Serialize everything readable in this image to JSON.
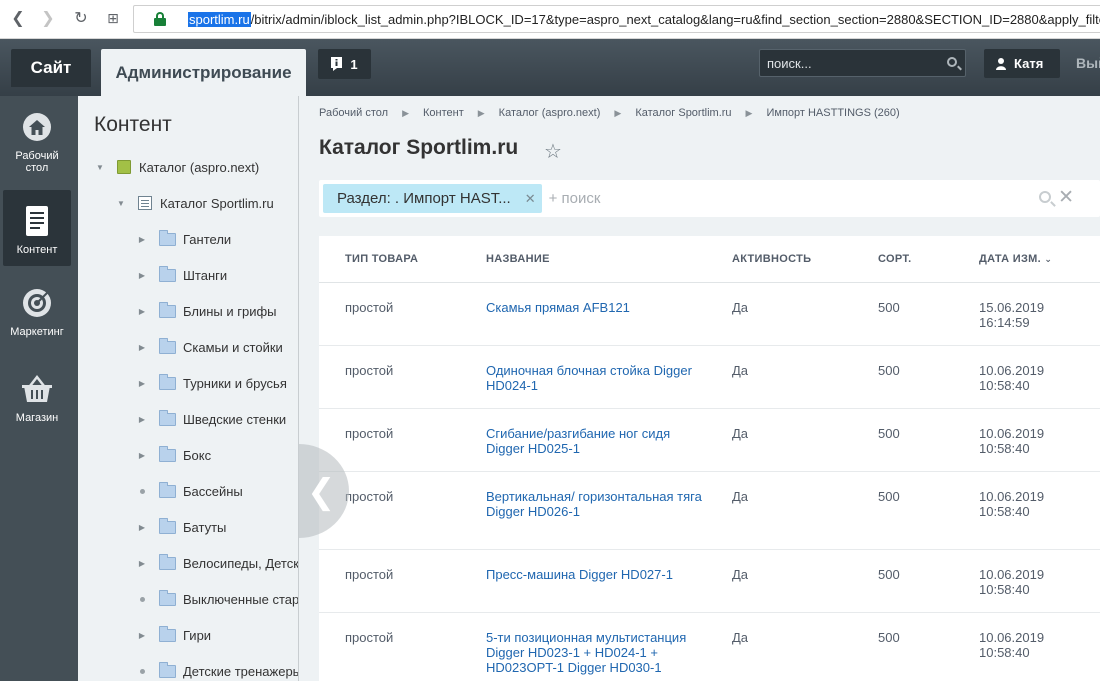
{
  "browser": {
    "url_host": "sportlim.ru",
    "url_rest": "/bitrix/admin/iblock_list_admin.php?IBLOCK_ID=17&type=aspro_next_catalog&lang=ru&find_section_section=2880&SECTION_ID=2880&apply_filter"
  },
  "topbar": {
    "site_tab": "Сайт",
    "admin_tab": "Администрирование",
    "notifications_count": "1",
    "search_placeholder": "поиск...",
    "user_name": "Катя",
    "exit_label": "Вый"
  },
  "menu": {
    "items": [
      {
        "label": "Рабочий стол",
        "icon": "home-icon"
      },
      {
        "label": "Контент",
        "icon": "document-icon"
      },
      {
        "label": "Маркетинг",
        "icon": "target-icon"
      },
      {
        "label": "Магазин",
        "icon": "basket-icon"
      }
    ]
  },
  "tree": {
    "title": "Контент",
    "root": "Каталог (aspro.next)",
    "iblock": "Каталог Sportlim.ru",
    "sections": [
      {
        "label": "Гантели",
        "expandable": true
      },
      {
        "label": "Штанги",
        "expandable": true
      },
      {
        "label": "Блины и грифы",
        "expandable": true
      },
      {
        "label": "Скамьи и стойки",
        "expandable": true
      },
      {
        "label": "Турники и брусья",
        "expandable": true
      },
      {
        "label": "Шведские стенки",
        "expandable": true
      },
      {
        "label": "Бокс",
        "expandable": true
      },
      {
        "label": "Бассейны",
        "expandable": false
      },
      {
        "label": "Батуты",
        "expandable": true
      },
      {
        "label": "Велосипеды, Детские",
        "expandable": true
      },
      {
        "label": "Выключенные старые",
        "expandable": false
      },
      {
        "label": "Гири",
        "expandable": true
      },
      {
        "label": "Детские тренажеры",
        "expandable": false
      }
    ]
  },
  "breadcrumb": [
    "Рабочий стол",
    "Контент",
    "Каталог (aspro.next)",
    "Каталог Sportlim.ru",
    "Импорт HASTTINGS (260)"
  ],
  "page_title": "Каталог Sportlim.ru",
  "filter": {
    "tag": "Раздел: . Импорт HAST...",
    "placeholder": "+ поиск"
  },
  "table": {
    "headers": [
      "ТИП ТОВАРА",
      "НАЗВАНИЕ",
      "АКТИВНОСТЬ",
      "СОРТ.",
      "ДАТА ИЗМ."
    ],
    "rows": [
      {
        "type": "простой",
        "name": "Скамья прямая AFB121",
        "active": "Да",
        "sort": "500",
        "date": "15.06.2019",
        "time": "16:14:59"
      },
      {
        "type": "простой",
        "name": "Одиночная блочная стойка Digger HD024-1",
        "active": "Да",
        "sort": "500",
        "date": "10.06.2019",
        "time": "10:58:40"
      },
      {
        "type": "простой",
        "name": "Сгибание/разгибание ног сидя Digger HD025-1",
        "active": "Да",
        "sort": "500",
        "date": "10.06.2019",
        "time": "10:58:40"
      },
      {
        "type": "простой",
        "name": "Вертикальная/ горизонтальная тяга Digger HD026-1",
        "active": "Да",
        "sort": "500",
        "date": "10.06.2019",
        "time": "10:58:40"
      },
      {
        "type": "простой",
        "name": "Пресс-машина Digger HD027-1",
        "active": "Да",
        "sort": "500",
        "date": "10.06.2019",
        "time": "10:58:40"
      },
      {
        "type": "простой",
        "name": "5-ти позиционная мультистанция Digger HD023-1 + HD024-1 + HD023OPT-1 Digger HD030-1",
        "active": "Да",
        "sort": "500",
        "date": "10.06.2019",
        "time": "10:58:40"
      }
    ]
  }
}
